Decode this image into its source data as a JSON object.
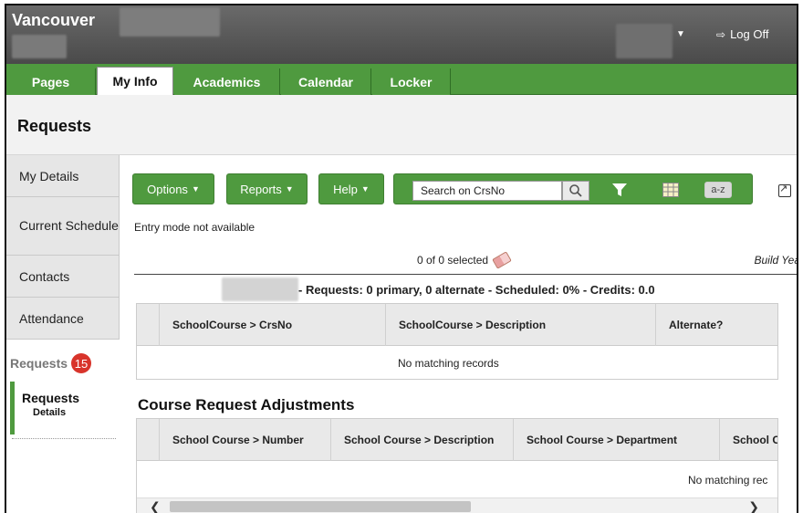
{
  "header": {
    "brand": "Vancouver",
    "logoff_label": "Log Off"
  },
  "tabs": [
    {
      "label": "Pages"
    },
    {
      "label": "My Info"
    },
    {
      "label": "Academics"
    },
    {
      "label": "Calendar"
    },
    {
      "label": "Locker"
    }
  ],
  "page": {
    "title": "Requests"
  },
  "sidebar": {
    "items": [
      {
        "label": "My Details"
      },
      {
        "label": "Current Schedule"
      },
      {
        "label": "Contacts"
      },
      {
        "label": "Attendance"
      }
    ],
    "section_label": "Requests",
    "badge_count": "15",
    "sub_title": "Requests",
    "sub_detail": "Details"
  },
  "toolbar": {
    "options_label": "Options",
    "reports_label": "Reports",
    "help_label": "Help",
    "search_placeholder": "Search on CrsNo",
    "az_label": "a-z"
  },
  "content": {
    "entry_mode": "Entry mode not available",
    "selected_count": "0 of 0 selected",
    "build_year": "Build Year",
    "summary": "- Requests: 0 primary, 0 alternate - Scheduled: 0% - Credits: 0.0"
  },
  "requests_table": {
    "columns": [
      "SchoolCourse > CrsNo",
      "SchoolCourse > Description",
      "Alternate?"
    ],
    "empty_text": "No matching records"
  },
  "adjustments": {
    "title": "Course Request Adjustments",
    "columns": [
      "School Course > Number",
      "School Course > Description",
      "School Course > Department",
      "School C"
    ],
    "empty_text": "No matching rec"
  },
  "colors": {
    "accent_green": "#4f9a3f",
    "header_gray": "#555555",
    "badge_red": "#d8342b"
  }
}
